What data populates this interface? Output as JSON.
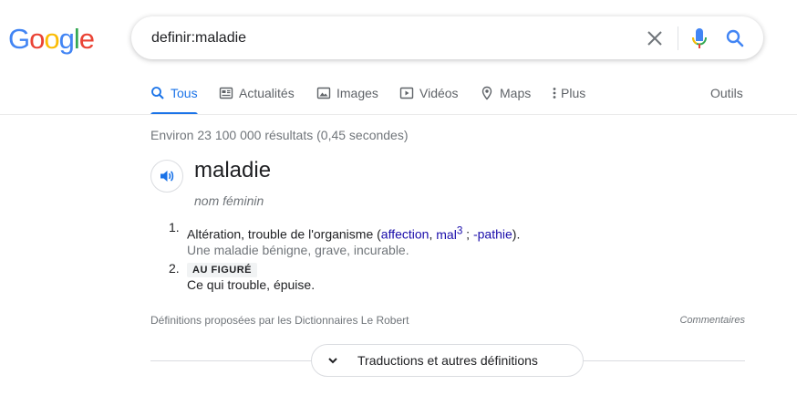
{
  "logo": {
    "letters": [
      "G",
      "o",
      "o",
      "g",
      "l",
      "e"
    ],
    "colors": [
      "#4285f4",
      "#ea4335",
      "#fbbc05",
      "#4285f4",
      "#34a853",
      "#ea4335"
    ]
  },
  "search": {
    "query": "definir:maladie",
    "clear_icon": "close-icon",
    "mic_icon": "mic-icon",
    "search_icon": "search-icon"
  },
  "tabs": [
    {
      "label": "Tous",
      "icon": "search-icon",
      "active": true
    },
    {
      "label": "Actualités",
      "icon": "news-icon"
    },
    {
      "label": "Images",
      "icon": "image-icon"
    },
    {
      "label": "Vidéos",
      "icon": "video-icon"
    },
    {
      "label": "Maps",
      "icon": "map-pin-icon"
    },
    {
      "label": "Plus",
      "icon": "more-vert-icon"
    }
  ],
  "tools_label": "Outils",
  "stats": "Environ 23 100 000 résultats (0,45 secondes)",
  "dictionary": {
    "word": "maladie",
    "part_of_speech": "nom féminin",
    "definitions": [
      {
        "number": "1.",
        "text_before": "Altération, trouble de l'organisme (",
        "link1": "affection",
        "sep1": ", ",
        "link2": "mal",
        "sup": "3",
        "sep2": " ; ",
        "link3": "-pathie",
        "text_after": ").",
        "example": "Une maladie bénigne, grave, incurable."
      },
      {
        "number": "2.",
        "tag": "AU FIGURÉ",
        "text": "Ce qui trouble, épuise."
      }
    ],
    "source": "Définitions proposées par les Dictionnaires Le Robert",
    "comments": "Commentaires"
  },
  "more_button": "Traductions et autres définitions",
  "colors": {
    "accent": "#1a73e8",
    "link": "#1a0dab",
    "muted": "#70757a"
  }
}
